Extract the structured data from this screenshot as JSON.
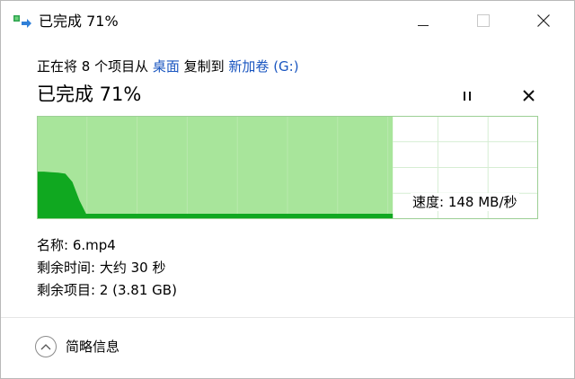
{
  "window": {
    "title": "已完成 71%"
  },
  "header": {
    "copy_prefix": "正在将 8 个项目从 ",
    "source": "桌面",
    "copy_middle": " 复制到 ",
    "destination": "新加卷 (G:)",
    "status": "已完成 71%"
  },
  "progress": {
    "percent": 71,
    "speed_label": "速度: 148 MB/秒",
    "speed_history_fraction": [
      0.46,
      0.46,
      0.455,
      0.45,
      0.44,
      0.36,
      0.18,
      0.04,
      0.02,
      0.02,
      0.02
    ],
    "colors": {
      "fill": "#a8e59b",
      "line": "#10a820",
      "grid_done": "#b9e9ae",
      "grid_todo": "#d6edd3"
    }
  },
  "details": {
    "name_label": "名称: ",
    "name_value": "6.mp4",
    "time_label": "剩余时间: ",
    "time_value": "大约 30 秒",
    "items_label": "剩余项目: ",
    "items_value": "2 (3.81 GB)"
  },
  "footer": {
    "collapse_label": "简略信息"
  },
  "icons": {
    "app": "copy-transfer-icon",
    "minimize": "minimize-icon",
    "maximize": "maximize-icon",
    "close": "close-icon",
    "pause": "pause-icon",
    "cancel": "cancel-x-icon",
    "collapse": "chevron-up-icon"
  }
}
